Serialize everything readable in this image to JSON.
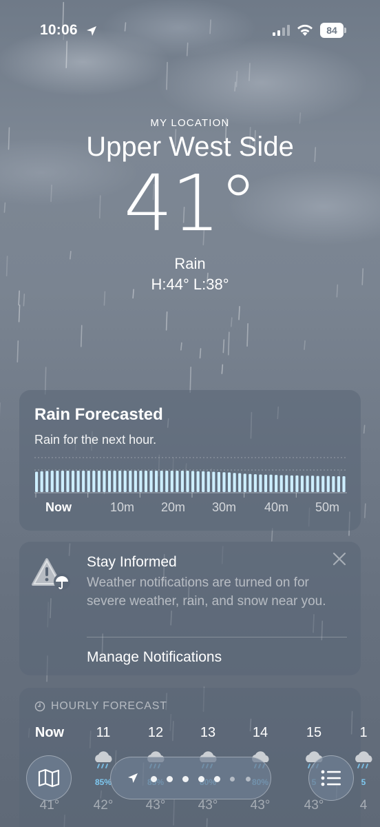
{
  "status_bar": {
    "time": "10:06",
    "battery": "84"
  },
  "hero": {
    "location_label": "MY LOCATION",
    "city": "Upper West Side",
    "temperature": "41°",
    "condition": "Rain",
    "high_low": "H:44°  L:38°"
  },
  "rain_card": {
    "title": "Rain Forecasted",
    "subtitle": "Rain for the next hour.",
    "time_labels": [
      "Now",
      "10m",
      "20m",
      "30m",
      "40m",
      "50m"
    ],
    "intensity": [
      0.82,
      0.84,
      0.85,
      0.86,
      0.86,
      0.86,
      0.86,
      0.86,
      0.86,
      0.86,
      0.86,
      0.86,
      0.86,
      0.86,
      0.86,
      0.86,
      0.86,
      0.86,
      0.86,
      0.86,
      0.86,
      0.86,
      0.86,
      0.86,
      0.86,
      0.86,
      0.86,
      0.86,
      0.86,
      0.86,
      0.85,
      0.84,
      0.84,
      0.83,
      0.82,
      0.81,
      0.8,
      0.79,
      0.77,
      0.76,
      0.74,
      0.73,
      0.72,
      0.71,
      0.7,
      0.7,
      0.69,
      0.68,
      0.68,
      0.67,
      0.67,
      0.66,
      0.66,
      0.66,
      0.65,
      0.65,
      0.65,
      0.64,
      0.64,
      0.64
    ],
    "bar_color": "#cdeeff"
  },
  "inform_card": {
    "title": "Stay Informed",
    "body": "Weather notifications are turned on for severe weather, rain, and snow near you.",
    "action": "Manage Notifications",
    "warn_icon": "warning-umbrella-icon",
    "close_icon": "close-icon"
  },
  "hourly_card": {
    "header": "HOURLY FORECAST",
    "hours": [
      {
        "label": "Now",
        "temp": "41°",
        "pct": ""
      },
      {
        "label": "11",
        "temp": "42°",
        "pct": "85%"
      },
      {
        "label": "12",
        "temp": "43°",
        "pct": "85%"
      },
      {
        "label": "13",
        "temp": "43°",
        "pct": "80%"
      },
      {
        "label": "14",
        "temp": "43°",
        "pct": "80%"
      },
      {
        "label": "15",
        "temp": "43°",
        "pct": "5"
      },
      {
        "label": "1",
        "temp": "4",
        "pct": "5"
      }
    ]
  },
  "bottom_bar": {
    "map_icon": "map-icon",
    "list_icon": "list-icon",
    "location_icon": "location-arrow-icon",
    "page_count": 8,
    "active_page": 0
  },
  "colors": {
    "accent_rain": "#7ec8f0",
    "card_bg": "rgba(90,102,118,0.55)"
  }
}
